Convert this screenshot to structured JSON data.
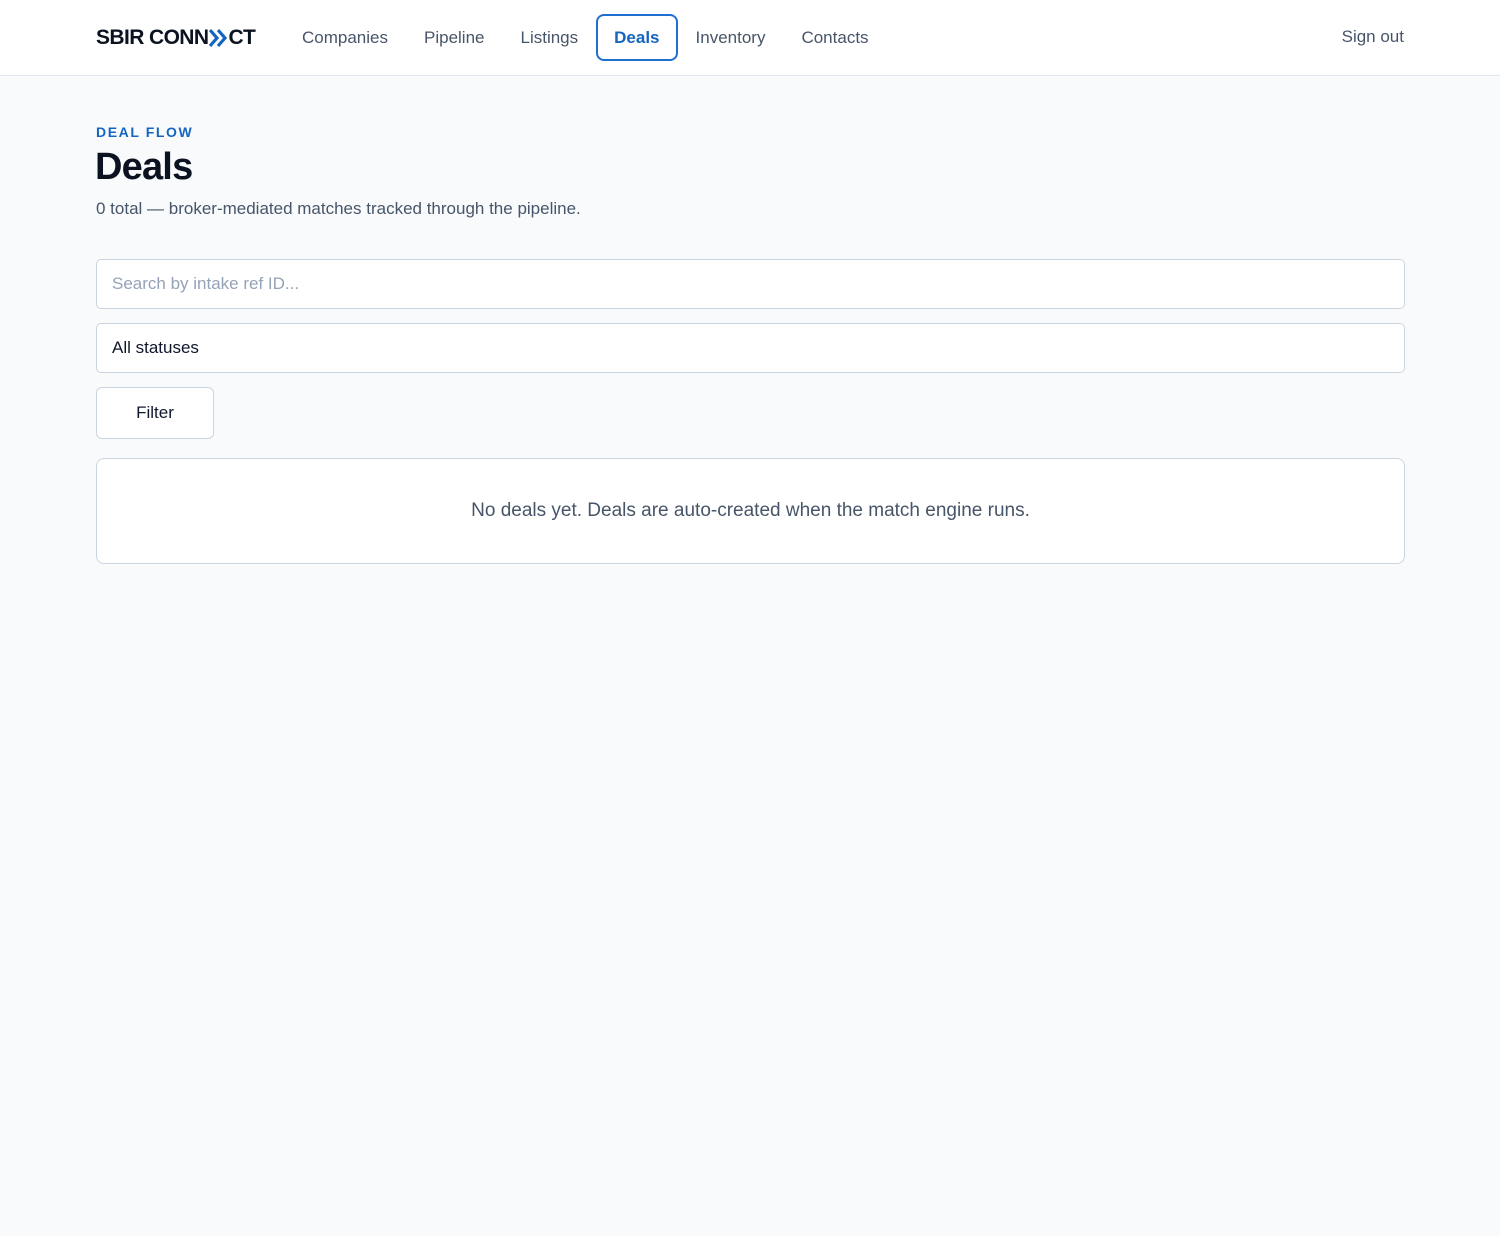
{
  "brand": {
    "logo_left": "SBIR CONN",
    "logo_right": "CT",
    "accent_color": "#1565c0"
  },
  "nav": {
    "items": [
      {
        "label": "Companies",
        "active": false
      },
      {
        "label": "Pipeline",
        "active": false
      },
      {
        "label": "Listings",
        "active": false
      },
      {
        "label": "Deals",
        "active": true
      },
      {
        "label": "Inventory",
        "active": false
      },
      {
        "label": "Contacts",
        "active": false
      }
    ],
    "signout_label": "Sign out"
  },
  "header": {
    "eyebrow": "DEAL FLOW",
    "title": "Deals",
    "subtitle": "0 total — broker-mediated matches tracked through the pipeline."
  },
  "filters": {
    "search_placeholder": "Search by intake ref ID...",
    "search_value": "",
    "status_selected": "All statuses",
    "filter_button": "Filter"
  },
  "empty_state": {
    "message": "No deals yet. Deals are auto-created when the match engine runs."
  }
}
